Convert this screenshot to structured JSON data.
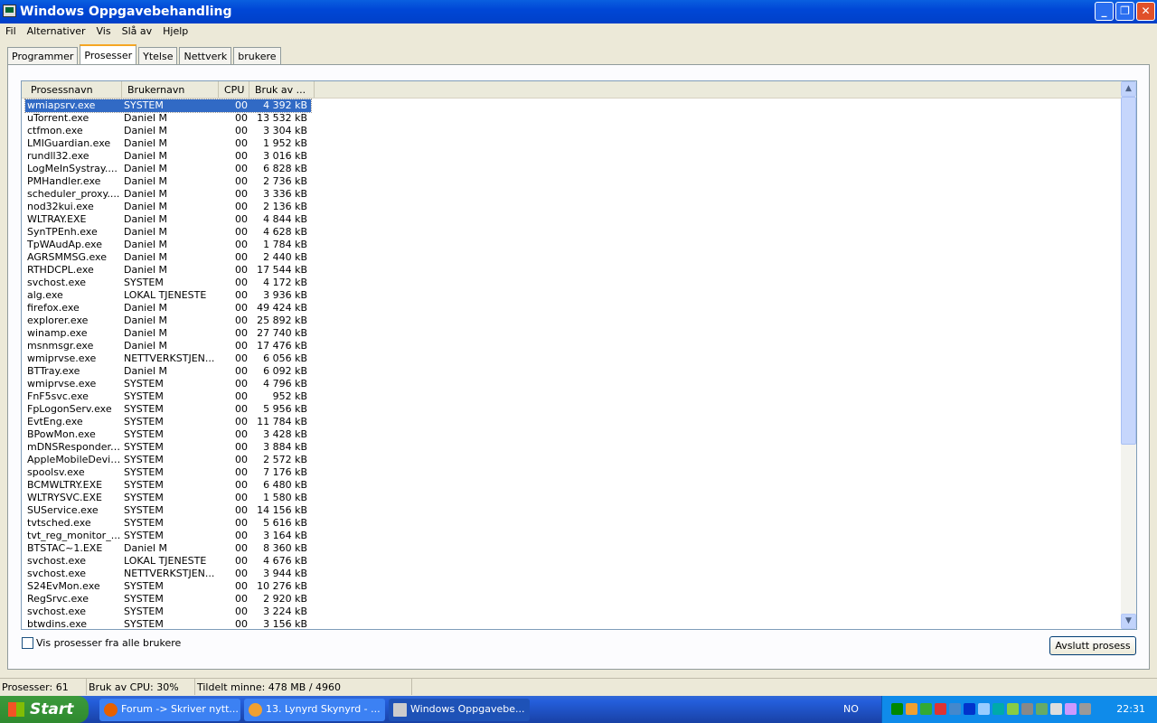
{
  "window": {
    "title": "Windows Oppgavebehandling"
  },
  "menu": [
    "Fil",
    "Alternativer",
    "Vis",
    "Slå av",
    "Hjelp"
  ],
  "tabs": [
    "Programmer",
    "Prosesser",
    "Ytelse",
    "Nettverk",
    "brukere"
  ],
  "columns": [
    "Prosessnavn",
    "Brukernavn",
    "CPU",
    "Bruk av ..."
  ],
  "processes": [
    [
      "wmiapsrv.exe",
      "SYSTEM",
      "00",
      "4 392 kB"
    ],
    [
      "uTorrent.exe",
      "Daniel M",
      "00",
      "13 532 kB"
    ],
    [
      "ctfmon.exe",
      "Daniel M",
      "00",
      "3 304 kB"
    ],
    [
      "LMIGuardian.exe",
      "Daniel M",
      "00",
      "1 952 kB"
    ],
    [
      "rundll32.exe",
      "Daniel M",
      "00",
      "3 016 kB"
    ],
    [
      "LogMeInSystray....",
      "Daniel M",
      "00",
      "6 828 kB"
    ],
    [
      "PMHandler.exe",
      "Daniel M",
      "00",
      "2 736 kB"
    ],
    [
      "scheduler_proxy....",
      "Daniel M",
      "00",
      "3 336 kB"
    ],
    [
      "nod32kui.exe",
      "Daniel M",
      "00",
      "2 136 kB"
    ],
    [
      "WLTRAY.EXE",
      "Daniel M",
      "00",
      "4 844 kB"
    ],
    [
      "SynTPEnh.exe",
      "Daniel M",
      "00",
      "4 628 kB"
    ],
    [
      "TpWAudAp.exe",
      "Daniel M",
      "00",
      "1 784 kB"
    ],
    [
      "AGRSMMSG.exe",
      "Daniel M",
      "00",
      "2 440 kB"
    ],
    [
      "RTHDCPL.exe",
      "Daniel M",
      "00",
      "17 544 kB"
    ],
    [
      "svchost.exe",
      "SYSTEM",
      "00",
      "4 172 kB"
    ],
    [
      "alg.exe",
      "LOKAL TJENESTE",
      "00",
      "3 936 kB"
    ],
    [
      "firefox.exe",
      "Daniel M",
      "00",
      "49 424 kB"
    ],
    [
      "explorer.exe",
      "Daniel M",
      "00",
      "25 892 kB"
    ],
    [
      "winamp.exe",
      "Daniel M",
      "00",
      "27 740 kB"
    ],
    [
      "msnmsgr.exe",
      "Daniel M",
      "00",
      "17 476 kB"
    ],
    [
      "wmiprvse.exe",
      "NETTVERKSTJEN...",
      "00",
      "6 056 kB"
    ],
    [
      "BTTray.exe",
      "Daniel M",
      "00",
      "6 092 kB"
    ],
    [
      "wmiprvse.exe",
      "SYSTEM",
      "00",
      "4 796 kB"
    ],
    [
      "FnF5svc.exe",
      "SYSTEM",
      "00",
      "952 kB"
    ],
    [
      "FpLogonServ.exe",
      "SYSTEM",
      "00",
      "5 956 kB"
    ],
    [
      "EvtEng.exe",
      "SYSTEM",
      "00",
      "11 784 kB"
    ],
    [
      "BPowMon.exe",
      "SYSTEM",
      "00",
      "3 428 kB"
    ],
    [
      "mDNSResponder....",
      "SYSTEM",
      "00",
      "3 884 kB"
    ],
    [
      "AppleMobileDevic...",
      "SYSTEM",
      "00",
      "2 572 kB"
    ],
    [
      "spoolsv.exe",
      "SYSTEM",
      "00",
      "7 176 kB"
    ],
    [
      "BCMWLTRY.EXE",
      "SYSTEM",
      "00",
      "6 480 kB"
    ],
    [
      "WLTRYSVC.EXE",
      "SYSTEM",
      "00",
      "1 580 kB"
    ],
    [
      "SUService.exe",
      "SYSTEM",
      "00",
      "14 156 kB"
    ],
    [
      "tvtsched.exe",
      "SYSTEM",
      "00",
      "5 616 kB"
    ],
    [
      "tvt_reg_monitor_...",
      "SYSTEM",
      "00",
      "3 164 kB"
    ],
    [
      "BTSTAC~1.EXE",
      "Daniel M",
      "00",
      "8 360 kB"
    ],
    [
      "svchost.exe",
      "LOKAL TJENESTE",
      "00",
      "4 676 kB"
    ],
    [
      "svchost.exe",
      "NETTVERKSTJEN...",
      "00",
      "3 944 kB"
    ],
    [
      "S24EvMon.exe",
      "SYSTEM",
      "00",
      "10 276 kB"
    ],
    [
      "RegSrvc.exe",
      "SYSTEM",
      "00",
      "2 920 kB"
    ],
    [
      "svchost.exe",
      "SYSTEM",
      "00",
      "3 224 kB"
    ],
    [
      "btwdins.exe",
      "SYSTEM",
      "00",
      "3 156 kB"
    ]
  ],
  "show_all_label": "Vis prosesser fra alle brukere",
  "end_process_label": "Avslutt prosess",
  "status": {
    "processes": "Prosesser: 61",
    "cpu": "Bruk av CPU: 30%",
    "memory": "Tildelt minne: 478 MB / 4960"
  },
  "taskbar": {
    "start": "Start",
    "tasks": [
      "Forum -> Skriver nytt...",
      "13. Lynyrd Skynyrd - ...",
      "Windows Oppgavebe..."
    ],
    "language": "NO",
    "clock": "22:31"
  }
}
